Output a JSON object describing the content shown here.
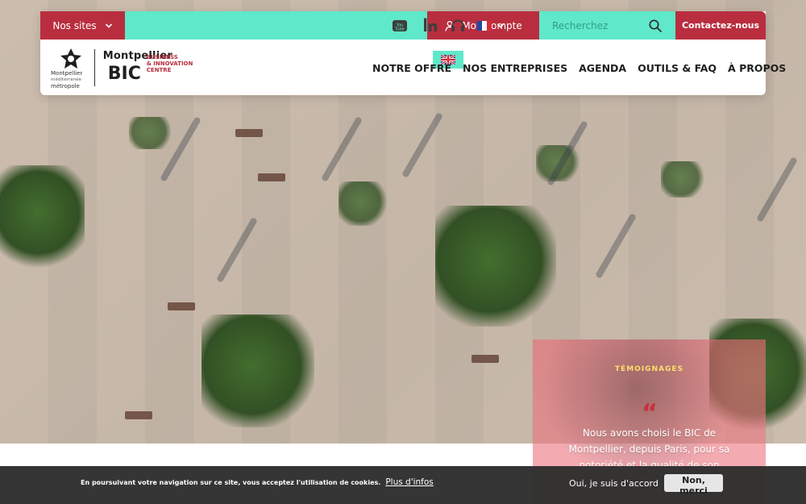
{
  "topbar": {
    "sites_label": "Nos sites",
    "account_label": "Mon compte",
    "search_placeholder": "Recherchez",
    "contact_label": "Contactez-nous",
    "accent": "#b92e3f",
    "teal": "#5fe8c9"
  },
  "social": {
    "youtube_label": "You Tube",
    "icons": [
      "youtube-icon",
      "linkedin-icon",
      "headphones-icon"
    ]
  },
  "language": {
    "current_flag": "fr-flag",
    "dropdown_flag": "uk-flag"
  },
  "logo": {
    "left_line1": "Montpellier",
    "left_line2": "méditerranée",
    "left_line3": "métropole",
    "right_title": "Montpellier",
    "right_mark": "BIC",
    "right_side_line1": "BUSINESS",
    "right_side_line2": "& INNOVATION",
    "right_side_line3": "CENTRE"
  },
  "nav": {
    "items": [
      "NOTRE OFFRE",
      "NOS ENTREPRISES",
      "AGENDA",
      "OUTILS & FAQ",
      "À PROPOS"
    ]
  },
  "testimonial": {
    "title": "TÉMOIGNAGES",
    "text": "Nous avons choisi le BIC de Montpellier, depuis Paris, pour sa notoriété et la qualité de son"
  },
  "cookie": {
    "text": "En poursuivant votre navigation sur ce site, vous acceptez l'utilisation de cookies.",
    "more_info": "Plus d'infos",
    "accept": "Oui, je suis d'accord",
    "decline": "Non, merci"
  }
}
